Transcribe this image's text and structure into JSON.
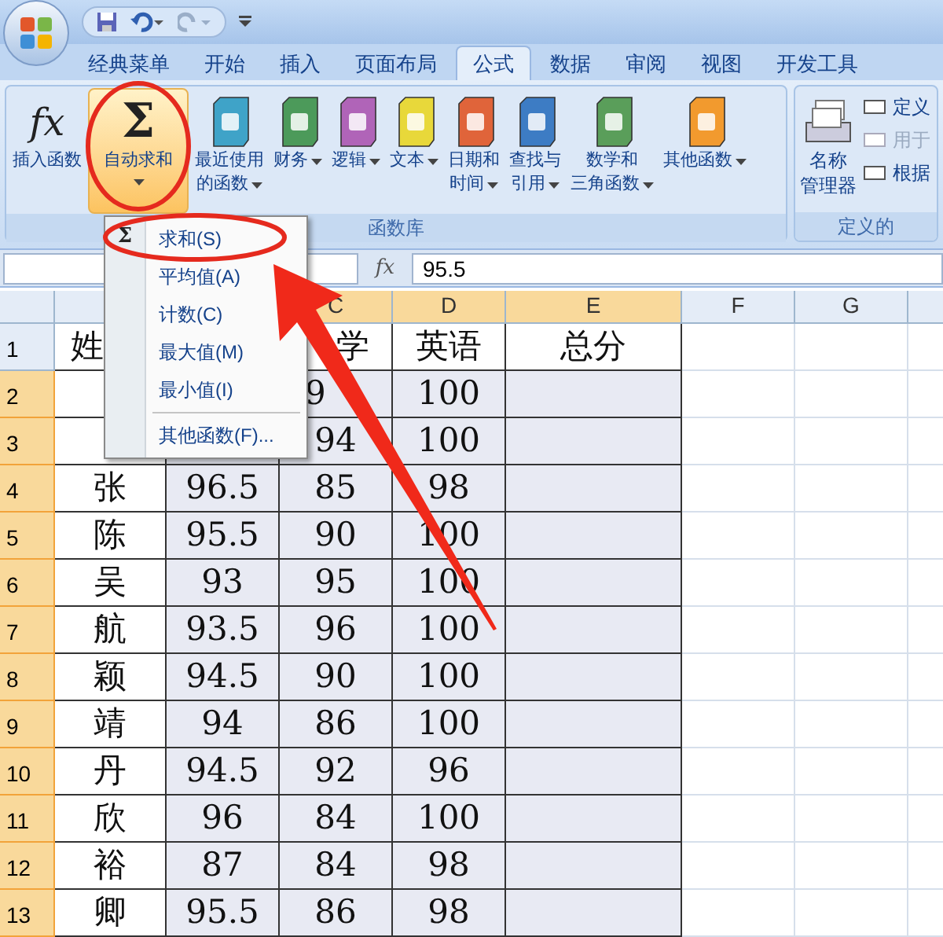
{
  "tabs": [
    {
      "label": "经典菜单",
      "selected": false
    },
    {
      "label": "开始",
      "selected": false
    },
    {
      "label": "插入",
      "selected": false
    },
    {
      "label": "页面布局",
      "selected": false
    },
    {
      "label": "公式",
      "selected": true
    },
    {
      "label": "数据",
      "selected": false
    },
    {
      "label": "审阅",
      "selected": false
    },
    {
      "label": "视图",
      "selected": false
    },
    {
      "label": "开发工具",
      "selected": false
    }
  ],
  "ribbon": {
    "function_library": {
      "label": "函数库",
      "buttons": [
        {
          "kind": "fx",
          "symbol": "fx",
          "lines": [
            "插入函数"
          ],
          "dropdown": false,
          "pressed": false
        },
        {
          "kind": "sigma",
          "symbol": "Σ",
          "lines": [
            "自动求和"
          ],
          "dropdown": true,
          "pressed": true
        },
        {
          "kind": "book",
          "color": "#3fa3c8",
          "lines": [
            "最近使用",
            "的函数"
          ],
          "dropdown": true,
          "pressed": false
        },
        {
          "kind": "book",
          "color": "#4c9a5a",
          "lines": [
            "财务"
          ],
          "dropdown": true,
          "pressed": false
        },
        {
          "kind": "book",
          "color": "#b064b8",
          "lines": [
            "逻辑"
          ],
          "dropdown": true,
          "pressed": false
        },
        {
          "kind": "book",
          "color": "#e8d83a",
          "lines": [
            "文本"
          ],
          "dropdown": true,
          "pressed": false
        },
        {
          "kind": "book",
          "color": "#e0643a",
          "lines": [
            "日期和",
            "时间"
          ],
          "dropdown": true,
          "pressed": false
        },
        {
          "kind": "book",
          "color": "#3d7cc4",
          "lines": [
            "查找与",
            "引用"
          ],
          "dropdown": true,
          "pressed": false
        },
        {
          "kind": "book",
          "color": "#5a9e5a",
          "lines": [
            "数学和",
            "三角函数"
          ],
          "dropdown": true,
          "pressed": false
        },
        {
          "kind": "book",
          "color": "#f29a2e",
          "lines": [
            "其他函数"
          ],
          "dropdown": true,
          "pressed": false
        }
      ]
    },
    "defined_names": {
      "label": "定义的",
      "manager": [
        "名称",
        "管理器"
      ],
      "items": [
        {
          "label": "定义",
          "disabled": false
        },
        {
          "label": "用于",
          "disabled": true
        },
        {
          "label": "根据",
          "disabled": false
        }
      ]
    }
  },
  "formula_bar": {
    "symbol": "fx",
    "value": "95.5"
  },
  "menu": {
    "symbol": "Σ",
    "items": [
      {
        "label": "求和(S)",
        "kind": "item"
      },
      {
        "label": "平均值(A)",
        "kind": "item"
      },
      {
        "label": "计数(C)",
        "kind": "item"
      },
      {
        "label": "最大值(M)",
        "kind": "item"
      },
      {
        "label": "最小值(I)",
        "kind": "item"
      },
      {
        "kind": "separator"
      },
      {
        "label": "其他函数(F)...",
        "kind": "item"
      }
    ]
  },
  "columns": [
    {
      "label": "C",
      "selected": true
    },
    {
      "label": "D",
      "selected": true
    },
    {
      "label": "E",
      "selected": true
    },
    {
      "label": "F",
      "selected": false
    },
    {
      "label": "G",
      "selected": false
    }
  ],
  "rows": [
    {
      "number": "1",
      "selected": false,
      "a": "姓",
      "c": "学",
      "d": "英语",
      "e": "总分"
    },
    {
      "number": "2",
      "selected": true,
      "c": "9",
      "d": "100"
    },
    {
      "number": "3",
      "selected": true,
      "c": "94",
      "d": "100"
    },
    {
      "number": "4",
      "selected": true,
      "a": "张",
      "b": "96.5",
      "c": "85",
      "d": "98"
    },
    {
      "number": "5",
      "selected": true,
      "a": "陈",
      "b": "95.5",
      "c": "90",
      "d": "100"
    },
    {
      "number": "6",
      "selected": true,
      "a": "吴",
      "b": "93",
      "c": "95",
      "d": "100"
    },
    {
      "number": "7",
      "selected": true,
      "a": "航",
      "b": "93.5",
      "c": "96",
      "d": "100"
    },
    {
      "number": "8",
      "selected": true,
      "a": "颖",
      "b": "94.5",
      "c": "90",
      "d": "100"
    },
    {
      "number": "9",
      "selected": true,
      "a": "靖",
      "b": "94",
      "c": "86",
      "d": "100"
    },
    {
      "number": "10",
      "selected": true,
      "a": "丹",
      "b": "94.5",
      "c": "92",
      "d": "96"
    },
    {
      "number": "11",
      "selected": true,
      "a": "欣",
      "b": "96",
      "c": "84",
      "d": "100"
    },
    {
      "number": "12",
      "selected": true,
      "a": "裕",
      "b": "87",
      "c": "84",
      "d": "98"
    },
    {
      "number": "13",
      "selected": true,
      "a": "卿",
      "b": "95.5",
      "c": "86",
      "d": "98"
    }
  ]
}
